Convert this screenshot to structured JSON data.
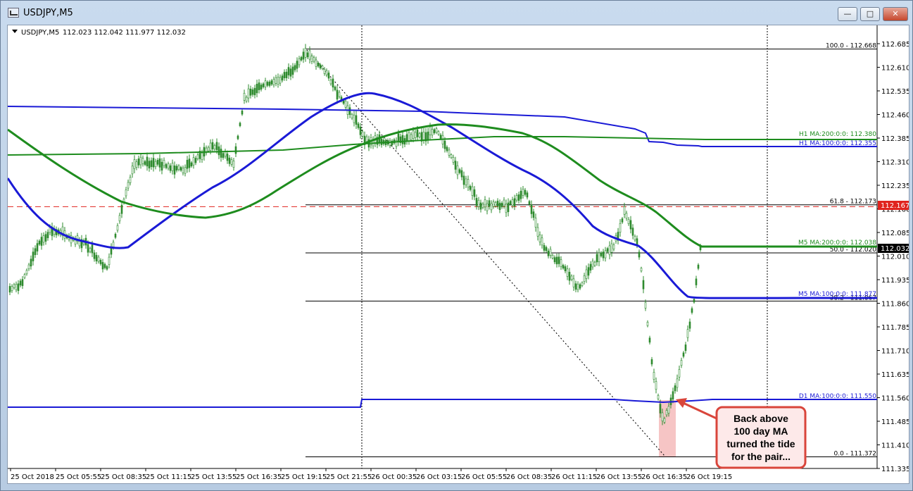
{
  "window": {
    "title": "USDJPY,M5",
    "controls": {
      "minimize": "—",
      "maximize": "□",
      "close": "✕"
    }
  },
  "chart_header": {
    "symbol": "USDJPY,M5",
    "ohlc": "112.023 112.042 111.977 112.032"
  },
  "price_axis": {
    "ticks": [
      "112.685",
      "112.610",
      "112.535",
      "112.460",
      "112.385",
      "112.310",
      "112.235",
      "112.160",
      "112.085",
      "112.010",
      "111.935",
      "111.860",
      "111.785",
      "111.710",
      "111.635",
      "111.560",
      "111.485",
      "111.410",
      "111.335"
    ],
    "current_price": "112.032",
    "line_price": "112.167",
    "colors": {
      "current_bg": "#000000",
      "line_bg": "#e0231e"
    }
  },
  "time_axis": {
    "labels": [
      "25 Oct 2018",
      "25 Oct 05:55",
      "25 Oct 08:35",
      "25 Oct 11:15",
      "25 Oct 13:55",
      "25 Oct 16:35",
      "25 Oct 19:15",
      "25 Oct 21:55",
      "26 Oct 00:35",
      "26 Oct 03:15",
      "26 Oct 05:55",
      "26 Oct 08:35",
      "26 Oct 11:15",
      "26 Oct 13:55",
      "26 Oct 16:35",
      "26 Oct 19:15"
    ]
  },
  "fib_levels": [
    {
      "label": "100.0 - 112.668",
      "price": 112.668
    },
    {
      "label": "61.8 - 112.173",
      "price": 112.173
    },
    {
      "label": "50.0 - 112.020",
      "price": 112.02
    },
    {
      "label": "38.2 - 111.867",
      "price": 111.867
    },
    {
      "label": "0.0 - 111.372",
      "price": 111.372
    }
  ],
  "ma_labels": [
    {
      "label": "H1 MA:200:0:0: 112.380",
      "color": "#1e8c1e"
    },
    {
      "label": "H1 MA:100:0:0: 112.355",
      "color": "#1a1ad6"
    },
    {
      "label": "M5 MA:200:0:0: 112.038",
      "color": "#1e8c1e"
    },
    {
      "label": "M5 MA:100:0:0: 111.877",
      "color": "#1a1ad6"
    },
    {
      "label": "D1 MA:100:0:0: 111.550",
      "color": "#1a1ad6"
    }
  ],
  "callout": {
    "lines": [
      "Back above",
      "100 day MA",
      "turned the tide",
      "for the pair..."
    ],
    "bg": "#fde9e9",
    "border": "#d9453b"
  },
  "colors": {
    "candle": "#2e8b2e",
    "ma_blue": "#1a1ad6",
    "ma_green": "#1e8c1e",
    "fib": "#000000",
    "hline": "#e0231e",
    "highlight": "#f6c5c5"
  }
}
